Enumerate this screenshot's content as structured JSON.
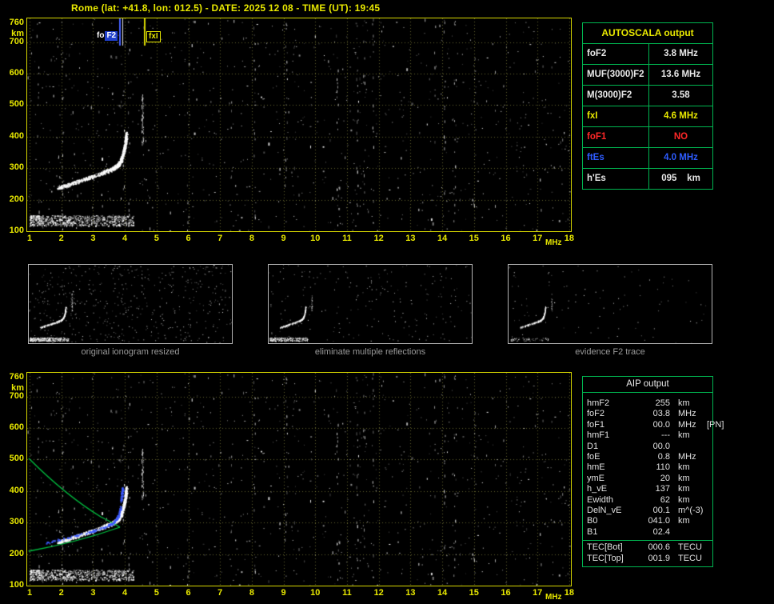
{
  "header": {
    "title": "Rome (lat: +41.8, lon: 012.5) - DATE: 2025 12 08 - TIME (UT): 19:45"
  },
  "colors": {
    "accent_yellow": "#e8e800",
    "table_green": "#00b450",
    "marker_blue": "#2e5cff",
    "alert_red": "#ff2828",
    "text_white": "#e8e8e8",
    "caption_gray": "#9a9a9a"
  },
  "axes": {
    "y_unit": "km",
    "x_unit": "MHz",
    "y_ticks": [
      "760",
      "700",
      "600",
      "500",
      "400",
      "300",
      "200",
      "100"
    ],
    "x_ticks": [
      "1",
      "2",
      "3",
      "4",
      "5",
      "6",
      "7",
      "8",
      "9",
      "10",
      "11",
      "12",
      "13",
      "14",
      "15",
      "16",
      "17",
      "18"
    ]
  },
  "markers": {
    "foF2_prefix": "fo",
    "foF2_main": "F2",
    "fxI": "fxI"
  },
  "autoscala": {
    "title": "AUTOSCALA output",
    "rows": [
      {
        "label": "foF2",
        "value": "3.8 MHz",
        "color": "#e8e8e8"
      },
      {
        "label": "MUF(3000)F2",
        "value": "13.6 MHz",
        "color": "#e8e8e8"
      },
      {
        "label": "M(3000)F2",
        "value": "3.58",
        "color": "#e8e8e8"
      },
      {
        "label": "fxI",
        "value": "4.6 MHz",
        "color": "#e8e800"
      },
      {
        "label": "foF1",
        "value": "NO",
        "color": "#ff2828"
      },
      {
        "label": "ftEs",
        "value": "4.0 MHz",
        "color": "#2e5cff"
      },
      {
        "label": "h'Es",
        "value": "095    km",
        "color": "#e8e8e8"
      }
    ]
  },
  "thumbnails": {
    "captions": [
      "original ionogram resized",
      "eliminate multiple reflections",
      "evidence F2 trace"
    ]
  },
  "aip": {
    "title": "AIP output",
    "rows": [
      {
        "name": "hmF2",
        "value": "255",
        "unit": "km",
        "note": ""
      },
      {
        "name": "foF2",
        "value": "03.8",
        "unit": "MHz",
        "note": ""
      },
      {
        "name": "foF1",
        "value": "00.0",
        "unit": "MHz",
        "note": "[PN]"
      },
      {
        "name": "hmF1",
        "value": "---",
        "unit": "km",
        "note": ""
      },
      {
        "name": "D1",
        "value": "00.0",
        "unit": "",
        "note": ""
      },
      {
        "name": "foE",
        "value": "0.8",
        "unit": "MHz",
        "note": ""
      },
      {
        "name": "hmE",
        "value": "110",
        "unit": "km",
        "note": ""
      },
      {
        "name": "ymE",
        "value": "20",
        "unit": "km",
        "note": ""
      },
      {
        "name": "h_vE",
        "value": "137",
        "unit": "km",
        "note": ""
      },
      {
        "name": "Ewidth",
        "value": "62",
        "unit": "km",
        "note": ""
      },
      {
        "name": "DelN_vE",
        "value": "00.1",
        "unit": "m^(-3)",
        "note": ""
      },
      {
        "name": "B0",
        "value": "041.0",
        "unit": "km",
        "note": ""
      },
      {
        "name": "B1",
        "value": "02.4",
        "unit": "",
        "note": ""
      }
    ],
    "tec_rows": [
      {
        "name": "TEC[Bot]",
        "value": "000.6",
        "unit": "TECU",
        "note": ""
      },
      {
        "name": "TEC[Top]",
        "value": "001.9",
        "unit": "TECU",
        "note": ""
      }
    ]
  }
}
